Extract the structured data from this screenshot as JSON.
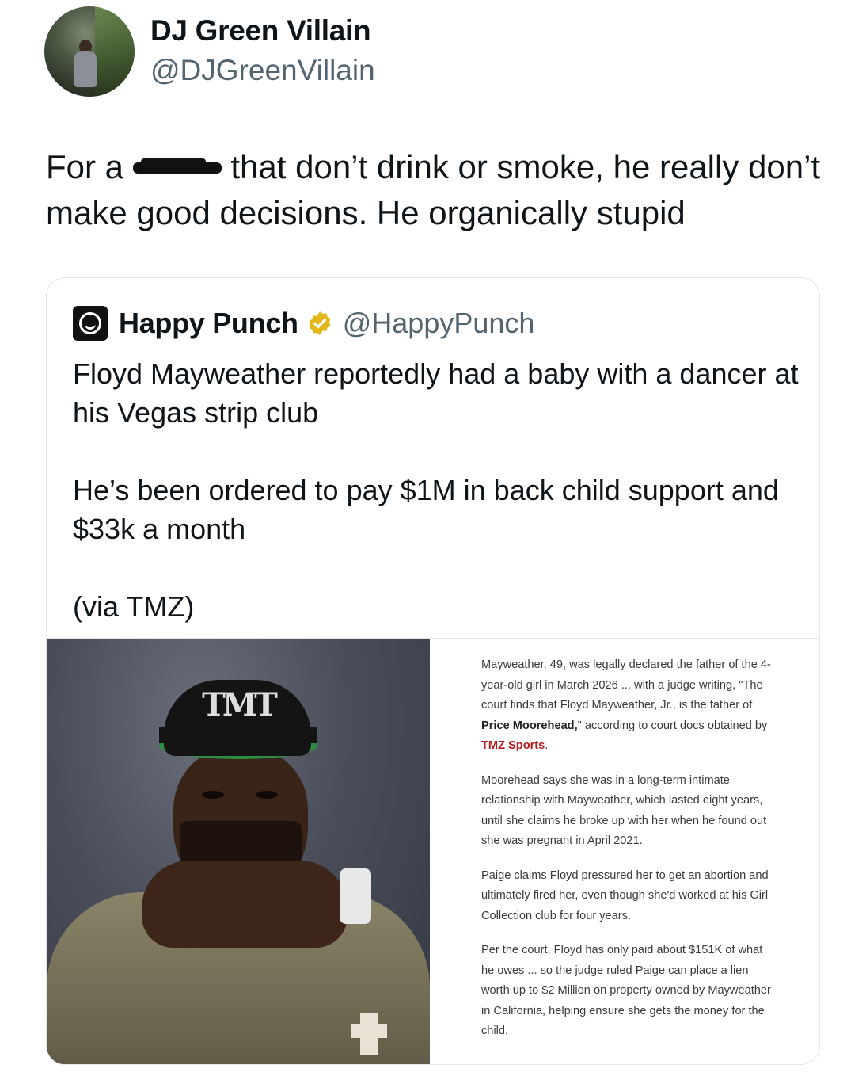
{
  "tweet": {
    "author": {
      "display_name": "DJ Green Villain",
      "handle": "@DJGreenVillain",
      "avatar_icon": "profile-photo"
    },
    "text": {
      "part1": "For a ",
      "censored_word_icon": "scribbled-out-word",
      "part2": " that don’t drink or smoke, he really don’t make good decisions. He organically stupid"
    }
  },
  "quoted_tweet": {
    "author": {
      "display_name": "Happy Punch",
      "handle": "@HappyPunch",
      "logo_icon": "smiley-face-icon",
      "verified_badge_icon": "gold-verified-badge-icon",
      "verified_color": "#e2b719"
    },
    "paragraphs": [
      "Floyd Mayweather reportedly had a baby with a dancer at his Vegas strip club",
      "He’s been ordered to pay $1M in back child support and $33k a month",
      "(via TMZ)"
    ],
    "media": {
      "photo": {
        "subject": "man in TMT cap with hands together",
        "cap_text": "TMT"
      },
      "article": {
        "p1": {
          "a": "Mayweather, 49, was legally declared the father of the 4-year-old girl in March 2026 ... with a judge writing, \"The court finds that Floyd Mayweather, Jr., is the father of ",
          "b": "Price Moorehead,",
          "c": "\" according to court docs obtained by ",
          "d": "TMZ Sports",
          "e": "."
        },
        "p2": "Moorehead says she was in a long-term intimate relationship with Mayweather, which lasted eight years, until she claims he broke up with her when he found out she was pregnant in April 2021.",
        "p3": "Paige claims Floyd pressured her to get an abortion and ultimately fired her, even though she'd worked at his Girl Collection club for four years.",
        "p4": "Per the court, Floyd has only paid about $151K of what he owes ... so the judge ruled Paige can place a lien worth up to $2 Million on property owned by Mayweather in California, helping ensure she gets the money for the child.",
        "link_color": "#b31b1b"
      }
    }
  }
}
